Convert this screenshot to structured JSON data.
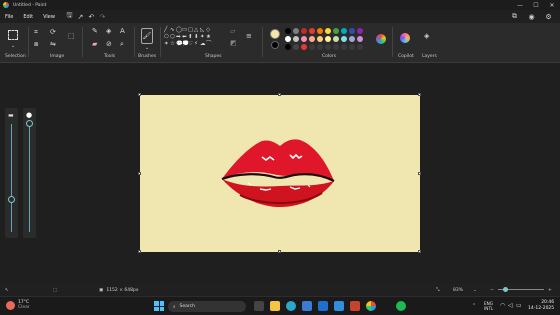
{
  "window": {
    "title": "Untitled - Paint",
    "min": "—",
    "max": "☐",
    "close": "✕"
  },
  "menu": {
    "file": "File",
    "edit": "Edit",
    "view": "View"
  },
  "ribbon": {
    "groups": {
      "selection": "Selection",
      "image": "Image",
      "tools": "Tools",
      "brushes": "Brushes",
      "shapes": "Shapes",
      "colors": "Colors",
      "copilot": "Copilot",
      "layers": "Layers"
    },
    "shapes": [
      "╱",
      "∿",
      "◯",
      "▭",
      "▢",
      "△",
      "◺",
      "◇",
      "⬠",
      "⬡",
      "➡",
      "⬅",
      "⬆",
      "⬇",
      "✦",
      "★",
      "✶",
      "☆",
      "💬",
      "💭",
      "♡",
      "⚡",
      "☁",
      "⌒"
    ],
    "primary_color": "#f5e7a8",
    "secondary_color": "#000000",
    "swatches": [
      "#000000",
      "#7f7f7f",
      "#c62828",
      "#e53935",
      "#f57c00",
      "#fdd835",
      "#43a047",
      "#00acc1",
      "#3949ab",
      "#8e24aa",
      "#ffffff",
      "#c3c3c3",
      "#f48fb1",
      "#ffab91",
      "#ffcc80",
      "#fff59d",
      "#c5e1a5",
      "#80deea",
      "#9fa8da",
      "#ce93d8",
      "#000000",
      "#444444",
      "#e53935",
      "#3a3a3a",
      "#3a3a3a",
      "#3a3a3a",
      "#3a3a3a",
      "#3a3a3a",
      "#3a3a3a",
      "#3a3a3a"
    ]
  },
  "canvas": {
    "background": "#f0e6b0"
  },
  "status": {
    "dimensions": "1152 × 648px",
    "zoom": "83%"
  },
  "taskbar": {
    "weather_temp": "17°C",
    "weather_desc": "Clear",
    "search_placeholder": "Search",
    "lang_line1": "ENG",
    "lang_line2": "INTL",
    "time": "20:46",
    "date": "14-12-2025"
  }
}
